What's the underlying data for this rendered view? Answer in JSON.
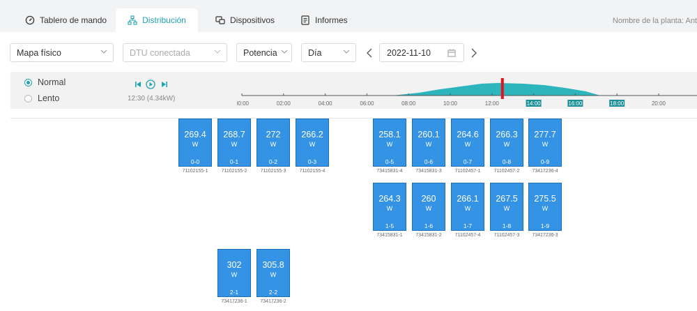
{
  "tabs": [
    {
      "label": "Tablero de mando",
      "icon": "dashboard-icon"
    },
    {
      "label": "Distribución",
      "icon": "distribution-icon"
    },
    {
      "label": "Dispositivos",
      "icon": "devices-icon"
    },
    {
      "label": "Informes",
      "icon": "reports-icon"
    }
  ],
  "plant_label": "Nombre de la planta: Ant",
  "filters": {
    "map_type": "Mapa físico",
    "dtu": "DTU conectada",
    "metric": "Potencia",
    "period": "Día",
    "date": "2022-11-10"
  },
  "playback": {
    "normal_label": "Normal",
    "slow_label": "Lento",
    "status": "12:30 (4.34kW)"
  },
  "timeline": {
    "ticks": [
      "00:00",
      "02:00",
      "04:00",
      "06:00",
      "08:00",
      "10:00",
      "12:00",
      "14:00",
      "16:00",
      "18:00",
      "20:00",
      "22"
    ],
    "current_time": "12:30",
    "colors": {
      "area": "#2cb5bd",
      "marker": "#e0141e",
      "highlight": "#1a8f97"
    }
  },
  "panels": [
    {
      "power": "269.4",
      "unit": "W",
      "pos": "0-0",
      "serial": "71102155-1"
    },
    {
      "power": "268.7",
      "unit": "W",
      "pos": "0-1",
      "serial": "71102155-2"
    },
    {
      "power": "272",
      "unit": "W",
      "pos": "0-2",
      "serial": "71102155-3"
    },
    {
      "power": "266.2",
      "unit": "W",
      "pos": "0-3",
      "serial": "71102155-4"
    },
    {
      "power": "258.1",
      "unit": "W",
      "pos": "0-5",
      "serial": "73415831-4"
    },
    {
      "power": "260.1",
      "unit": "W",
      "pos": "0-6",
      "serial": "73415831-3"
    },
    {
      "power": "264.6",
      "unit": "W",
      "pos": "0-7",
      "serial": "71102457-1"
    },
    {
      "power": "266.3",
      "unit": "W",
      "pos": "0-8",
      "serial": "71102457-2"
    },
    {
      "power": "277.7",
      "unit": "W",
      "pos": "0-9",
      "serial": "73417236-4"
    },
    {
      "power": "264.3",
      "unit": "W",
      "pos": "1-5",
      "serial": "73415831-1"
    },
    {
      "power": "260",
      "unit": "W",
      "pos": "1-6",
      "serial": "73415831-2"
    },
    {
      "power": "266.1",
      "unit": "W",
      "pos": "1-7",
      "serial": "71102457-4"
    },
    {
      "power": "267.5",
      "unit": "W",
      "pos": "1-8",
      "serial": "71102457-3"
    },
    {
      "power": "275.5",
      "unit": "W",
      "pos": "1-9",
      "serial": "73417236-3"
    },
    {
      "power": "302",
      "unit": "W",
      "pos": "2-1",
      "serial": "73417236-1"
    },
    {
      "power": "305.8",
      "unit": "W",
      "pos": "2-2",
      "serial": "73417236-2"
    }
  ],
  "colors": {
    "accent": "#1fa3ae",
    "panel": "#3593e6"
  }
}
